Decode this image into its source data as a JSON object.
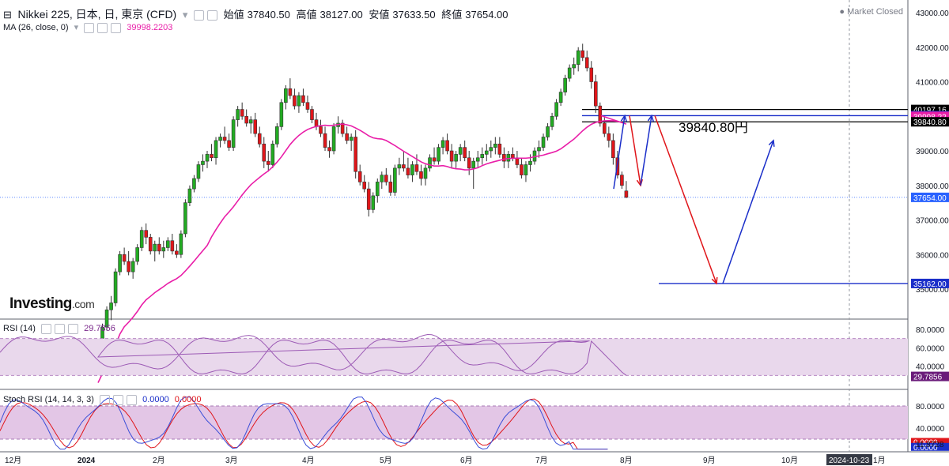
{
  "header": {
    "symbol": "Nikkei 225, 日本, 日, 東京 (CFD)",
    "open_label": "始値",
    "open": "37840.50",
    "high_label": "高値",
    "high": "38127.00",
    "low_label": "安値",
    "low": "37633.50",
    "close_label": "終値",
    "close": "37654.00",
    "ma_label": "MA (26, close, 0)",
    "ma_value": "39998.2203",
    "market_status": "Market Closed"
  },
  "logo": {
    "main": "Investing",
    "suffix": ".com"
  },
  "rsi_panel": {
    "label": "RSI (14)",
    "value": "29.7856",
    "ticks": [
      "80.0000",
      "60.0000",
      "40.0000"
    ],
    "last": "29.7856"
  },
  "stoch_panel": {
    "label": "Stoch RSI (14, 14, 3, 3)",
    "k_value": "0.0000",
    "d_value": "0.0000",
    "ticks": [
      "80.0000",
      "40.0000"
    ],
    "k_last": "0.0000",
    "d_last": "0.0000",
    "lower_band": "11.8728"
  },
  "annotation": {
    "target_text": "39840.80円"
  },
  "colors": {
    "up": "#22ab22",
    "down": "#e0161a",
    "ma": "#e91ea8",
    "rsi": "#9c5ab5",
    "k": "#3b4fd8",
    "d": "#e0151a",
    "band": "#e9d8ec",
    "arrow_up": "#1a2ec9",
    "arrow_down": "#e0151a"
  },
  "chart_data": {
    "type": "candlestick",
    "title": "Nikkei 225, 日本, 日, 東京 (CFD)",
    "price_axis": {
      "ticks": [
        43000,
        42000,
        41000,
        40000,
        39000,
        38000,
        37000,
        36000,
        35000
      ]
    },
    "x_labels": [
      "12月",
      "2024",
      "2月",
      "3月",
      "4月",
      "5月",
      "6月",
      "7月",
      "8月",
      "9月",
      "10月",
      "2024-10-23",
      "1月"
    ],
    "price_levels": [
      {
        "label": "40197.16",
        "value": 40197.16,
        "color": "#000000"
      },
      {
        "label": "40018.98",
        "value": 40018.98,
        "color": "#1a2ec9"
      },
      {
        "label": "39998.22",
        "value": 39998.22,
        "color": "#e91ea8"
      },
      {
        "label": "39840.80",
        "value": 39840.8,
        "color": "#000000"
      },
      {
        "label": "37654.00",
        "value": 37654.0,
        "color": "#2962ff"
      },
      {
        "label": "35162.00",
        "value": 35162.0,
        "color": "#1a2ec9"
      }
    ],
    "candles": [
      [
        33200,
        33500,
        32900,
        33460
      ],
      [
        33460,
        34000,
        33300,
        33900
      ],
      [
        33900,
        34500,
        33800,
        34400
      ],
      [
        34400,
        34800,
        34100,
        34600
      ],
      [
        34600,
        35600,
        34500,
        35500
      ],
      [
        35500,
        36100,
        35400,
        36000
      ],
      [
        36000,
        36200,
        35700,
        35800
      ],
      [
        35800,
        36100,
        35400,
        35500
      ],
      [
        35500,
        35900,
        35300,
        35800
      ],
      [
        35800,
        36300,
        35700,
        36200
      ],
      [
        36200,
        36800,
        36100,
        36700
      ],
      [
        36700,
        36900,
        36300,
        36500
      ],
      [
        36500,
        36600,
        36000,
        36100
      ],
      [
        36100,
        36400,
        35800,
        36300
      ],
      [
        36300,
        36500,
        36000,
        36100
      ],
      [
        36100,
        36400,
        35900,
        36200
      ],
      [
        36200,
        36500,
        36100,
        36400
      ],
      [
        36400,
        36600,
        36000,
        36100
      ],
      [
        36100,
        36300,
        35900,
        36000
      ],
      [
        36000,
        36700,
        35900,
        36600
      ],
      [
        36600,
        37600,
        36500,
        37500
      ],
      [
        37500,
        38000,
        37400,
        37900
      ],
      [
        37900,
        38300,
        37800,
        38200
      ],
      [
        38200,
        38700,
        38100,
        38600
      ],
      [
        38600,
        38900,
        38400,
        38700
      ],
      [
        38700,
        39000,
        38500,
        38900
      ],
      [
        38900,
        39200,
        38700,
        38800
      ],
      [
        38800,
        39400,
        38600,
        39300
      ],
      [
        39300,
        39500,
        39100,
        39400
      ],
      [
        39400,
        39700,
        39200,
        39300
      ],
      [
        39300,
        39500,
        39000,
        39100
      ],
      [
        39100,
        40000,
        39000,
        39900
      ],
      [
        39900,
        40300,
        39700,
        40200
      ],
      [
        40200,
        40400,
        39900,
        40000
      ],
      [
        40000,
        40200,
        39700,
        39800
      ],
      [
        39800,
        40000,
        39500,
        39900
      ],
      [
        39900,
        40100,
        39400,
        39500
      ],
      [
        39500,
        39700,
        39100,
        39200
      ],
      [
        39200,
        39400,
        38500,
        38700
      ],
      [
        38700,
        39000,
        38400,
        38600
      ],
      [
        38600,
        39300,
        38500,
        39200
      ],
      [
        39200,
        39800,
        39100,
        39700
      ],
      [
        39700,
        40500,
        39600,
        40400
      ],
      [
        40400,
        40900,
        40200,
        40800
      ],
      [
        40800,
        41100,
        40500,
        40600
      ],
      [
        40600,
        40800,
        40200,
        40300
      ],
      [
        40300,
        40700,
        40100,
        40600
      ],
      [
        40600,
        40800,
        40300,
        40400
      ],
      [
        40400,
        40600,
        40100,
        40200
      ],
      [
        40200,
        40300,
        39800,
        39900
      ],
      [
        39900,
        40100,
        39600,
        39700
      ],
      [
        39700,
        39900,
        39400,
        39500
      ],
      [
        39500,
        39700,
        39000,
        39100
      ],
      [
        39100,
        39300,
        38800,
        39000
      ],
      [
        39000,
        39800,
        38900,
        39700
      ],
      [
        39700,
        40000,
        39500,
        39800
      ],
      [
        39800,
        39900,
        39400,
        39500
      ],
      [
        39500,
        39700,
        39200,
        39300
      ],
      [
        39300,
        39500,
        39000,
        39400
      ],
      [
        39400,
        39600,
        38200,
        38400
      ],
      [
        38400,
        38600,
        38000,
        38100
      ],
      [
        38100,
        38300,
        37800,
        37900
      ],
      [
        37900,
        38100,
        37100,
        37300
      ],
      [
        37300,
        37800,
        37200,
        37700
      ],
      [
        37700,
        38200,
        37500,
        38100
      ],
      [
        38100,
        38400,
        37900,
        38300
      ],
      [
        38300,
        38500,
        38000,
        38100
      ],
      [
        38100,
        38300,
        37700,
        37800
      ],
      [
        37800,
        38600,
        37700,
        38500
      ],
      [
        38500,
        38800,
        38300,
        38600
      ],
      [
        38600,
        39000,
        38400,
        38500
      ],
      [
        38500,
        38800,
        38200,
        38300
      ],
      [
        38300,
        38700,
        38100,
        38600
      ],
      [
        38600,
        38900,
        38300,
        38400
      ],
      [
        38400,
        38600,
        38000,
        38200
      ],
      [
        38200,
        38600,
        38000,
        38500
      ],
      [
        38500,
        38900,
        38400,
        38800
      ],
      [
        38800,
        39100,
        38600,
        38700
      ],
      [
        38700,
        39200,
        38600,
        39100
      ],
      [
        39100,
        39400,
        38900,
        39300
      ],
      [
        39300,
        39500,
        38900,
        39000
      ],
      [
        39000,
        39200,
        38500,
        38700
      ],
      [
        38700,
        39000,
        38500,
        38900
      ],
      [
        38900,
        39200,
        38700,
        39100
      ],
      [
        39100,
        39300,
        38700,
        38800
      ],
      [
        38800,
        39000,
        38300,
        38500
      ],
      [
        38500,
        38800,
        37900,
        38700
      ],
      [
        38700,
        39000,
        38500,
        38800
      ],
      [
        38800,
        39100,
        38600,
        38900
      ],
      [
        38900,
        39200,
        38700,
        39000
      ],
      [
        39000,
        39300,
        38800,
        39100
      ],
      [
        39100,
        39400,
        38900,
        39200
      ],
      [
        39200,
        39400,
        38800,
        38900
      ],
      [
        38900,
        39100,
        38500,
        38700
      ],
      [
        38700,
        39000,
        38500,
        38900
      ],
      [
        38900,
        39100,
        38700,
        38800
      ],
      [
        38800,
        39000,
        38500,
        38600
      ],
      [
        38600,
        38800,
        38200,
        38300
      ],
      [
        38300,
        38700,
        38100,
        38600
      ],
      [
        38600,
        38900,
        38400,
        38700
      ],
      [
        38700,
        39100,
        38600,
        39000
      ],
      [
        39000,
        39300,
        38800,
        39100
      ],
      [
        39100,
        39500,
        39000,
        39400
      ],
      [
        39400,
        39800,
        39300,
        39700
      ],
      [
        39700,
        40100,
        39600,
        40000
      ],
      [
        40000,
        40500,
        39900,
        40400
      ],
      [
        40400,
        40800,
        40300,
        40700
      ],
      [
        40700,
        41200,
        40600,
        41100
      ],
      [
        41100,
        41500,
        41000,
        41400
      ],
      [
        41400,
        41700,
        41200,
        41500
      ],
      [
        41500,
        42000,
        41300,
        41900
      ],
      [
        41900,
        42100,
        41600,
        41700
      ],
      [
        41700,
        41900,
        41300,
        41400
      ],
      [
        41400,
        41600,
        40800,
        41000
      ],
      [
        41000,
        41200,
        40100,
        40300
      ],
      [
        40300,
        40400,
        39700,
        39800
      ],
      [
        39800,
        40000,
        39400,
        39500
      ],
      [
        39500,
        39700,
        39100,
        39300
      ],
      [
        39300,
        39500,
        38600,
        38800
      ],
      [
        38800,
        39000,
        38200,
        38300
      ],
      [
        38300,
        38400,
        37900,
        38000
      ],
      [
        37840.5,
        38127,
        37633.5,
        37654
      ]
    ],
    "ma_period": 26,
    "arrows": [
      {
        "from": [
          37800,
          7
        ],
        "to": [
          40018.98,
          9
        ],
        "color": "#1a2ec9"
      },
      {
        "from": [
          40018.98,
          9
        ],
        "to": [
          38000,
          12
        ],
        "color": "#e0151a"
      },
      {
        "from": [
          38000,
          12
        ],
        "to": [
          40018.98,
          15
        ],
        "color": "#1a2ec9"
      },
      {
        "from": [
          40018.98,
          15
        ],
        "to": [
          35162,
          30
        ],
        "color": "#e0151a"
      },
      {
        "from": [
          35162,
          31
        ],
        "to": [
          39300,
          40
        ],
        "color": "#1a2ec9"
      }
    ]
  }
}
